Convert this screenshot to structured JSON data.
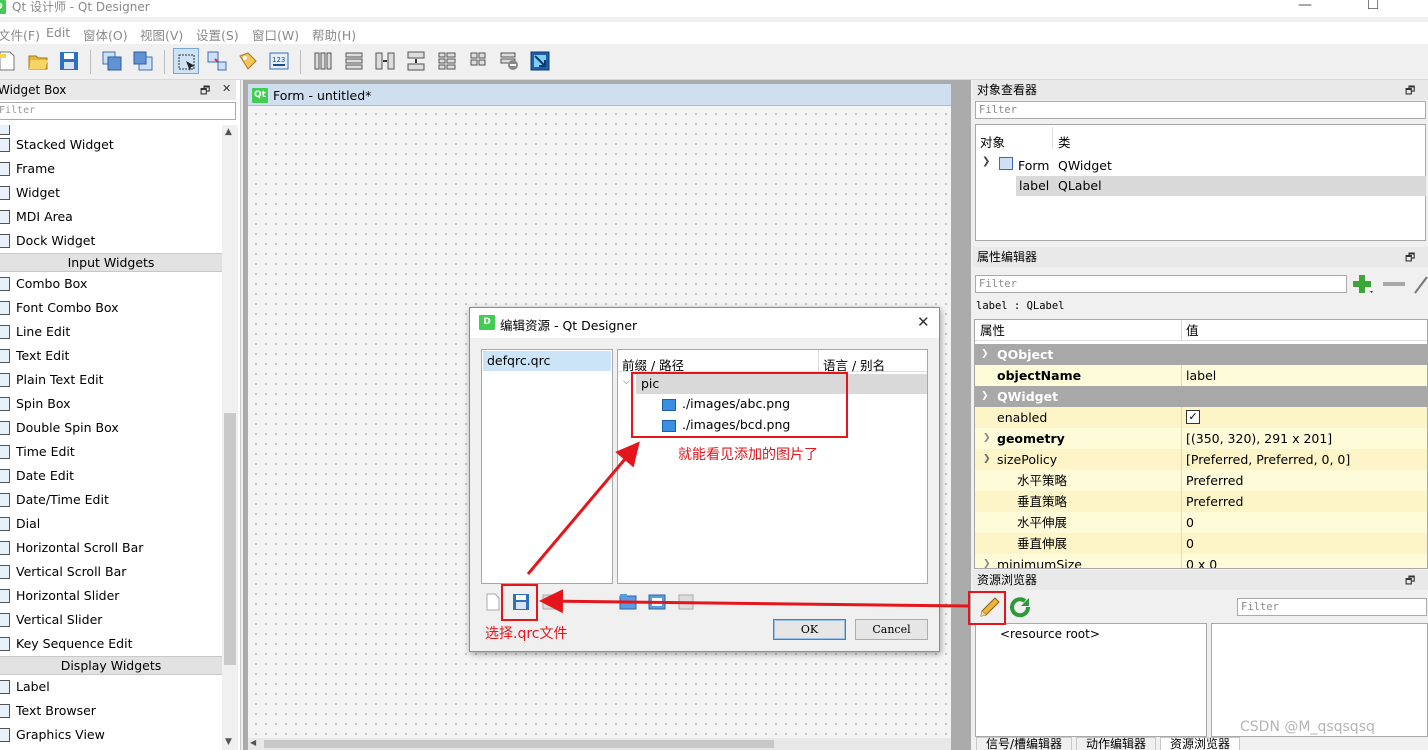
{
  "app": {
    "title": "Qt 设计师 - Qt Designer",
    "menu": [
      "文件(F)",
      "Edit",
      "窗体(O)",
      "视图(V)",
      "设置(S)",
      "窗口(W)",
      "帮助(H)"
    ]
  },
  "widget_box": {
    "title": "Widget Box",
    "filter_placeholder": "Filter",
    "items_top": [
      "Stacked Widget",
      "Frame",
      "Widget",
      "MDI Area",
      "Dock Widget"
    ],
    "cat_input": "Input Widgets",
    "items_input": [
      "Combo Box",
      "Font Combo Box",
      "Line Edit",
      "Text Edit",
      "Plain Text Edit",
      "Spin Box",
      "Double Spin Box",
      "Time Edit",
      "Date Edit",
      "Date/Time Edit",
      "Dial",
      "Horizontal Scroll Bar",
      "Vertical Scroll Bar",
      "Horizontal Slider",
      "Vertical Slider",
      "Key Sequence Edit"
    ],
    "cat_display": "Display Widgets",
    "items_display": [
      "Label",
      "Text Browser",
      "Graphics View"
    ]
  },
  "form": {
    "title": "Form - untitled*"
  },
  "object_inspector": {
    "title": "对象查看器",
    "filter_placeholder": "Filter",
    "col_object": "对象",
    "col_class": "类",
    "rows": [
      {
        "object": "Form",
        "class": "QWidget"
      },
      {
        "object": "label",
        "class": "QLabel"
      }
    ]
  },
  "property_editor": {
    "title": "属性编辑器",
    "filter_placeholder": "Filter",
    "context": "label : QLabel",
    "col_prop": "属性",
    "col_value": "值",
    "group_qobject": "QObject",
    "group_qwidget": "QWidget",
    "rows": [
      {
        "name": "objectName",
        "value": "label"
      },
      {
        "name": "enabled",
        "value": ""
      },
      {
        "name": "geometry",
        "value": "[(350, 320), 291 x 201]"
      },
      {
        "name": "sizePolicy",
        "value": "[Preferred, Preferred, 0, 0]"
      },
      {
        "name": "水平策略",
        "value": "Preferred"
      },
      {
        "name": "垂直策略",
        "value": "Preferred"
      },
      {
        "name": "水平伸展",
        "value": "0"
      },
      {
        "name": "垂直伸展",
        "value": "0"
      },
      {
        "name": "minimumSize",
        "value": "0 x 0"
      }
    ]
  },
  "resource_browser": {
    "title": "资源浏览器",
    "filter_placeholder": "Filter",
    "root": "<resource root>",
    "tabs": [
      "信号/槽编辑器",
      "动作编辑器",
      "资源浏览器"
    ]
  },
  "dialog": {
    "title": "编辑资源 - Qt Designer",
    "close": "✕",
    "qrc_file": "defqrc.qrc",
    "col_prefix": "前缀 / 路径",
    "col_lang": "语言 / 别名",
    "prefix": "pic",
    "files": [
      "./images/abc.png",
      "./images/bcd.png"
    ],
    "ok": "OK",
    "cancel": "Cancel"
  },
  "annotations": {
    "see_images": "就能看见添加的图片了",
    "select_qrc": "选择.qrc文件"
  },
  "watermark": "CSDN @M_qsqsqsq",
  "colors": {
    "qt_green": "#41cd52",
    "annotation_red": "#e4161c",
    "selection": "#cfe3f7"
  }
}
